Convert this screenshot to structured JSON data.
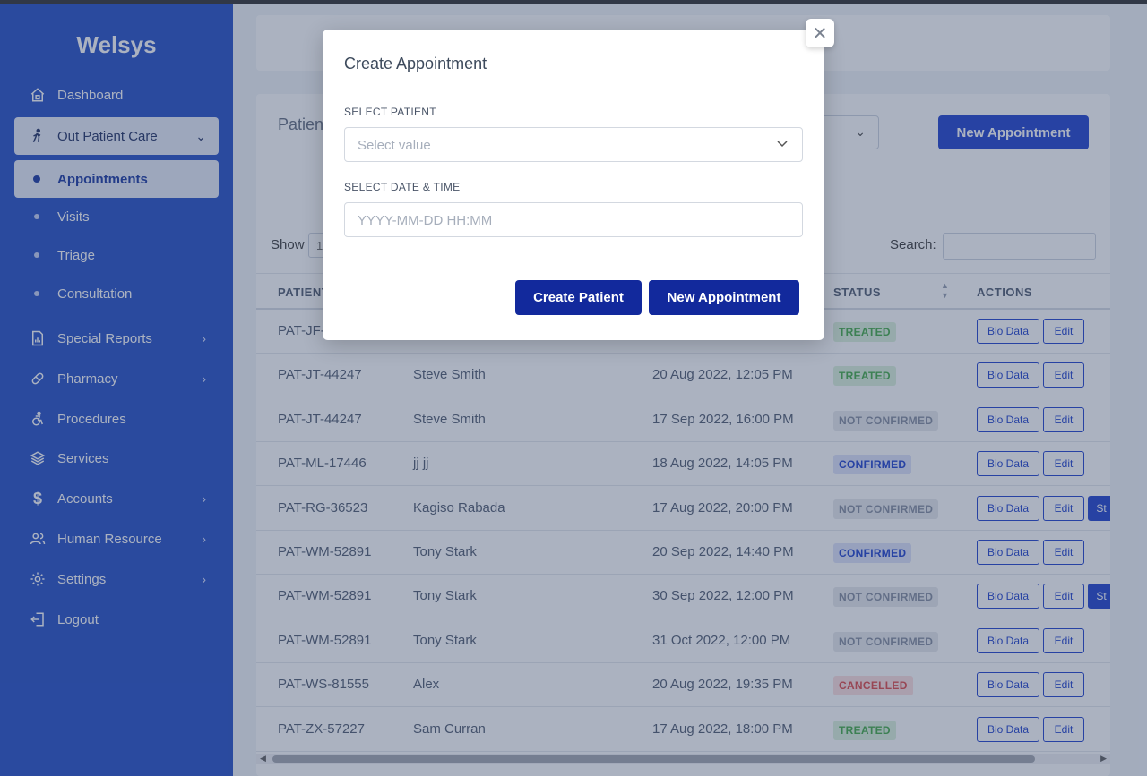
{
  "app": {
    "brand": "Welsys"
  },
  "sidebar": {
    "items": [
      {
        "label": "Dashboard",
        "icon": "home-icon"
      },
      {
        "label": "Out Patient Care",
        "icon": "walking-icon"
      },
      {
        "label": "Appointments"
      },
      {
        "label": "Visits"
      },
      {
        "label": "Triage"
      },
      {
        "label": "Consultation"
      },
      {
        "label": "Special Reports",
        "icon": "report-icon"
      },
      {
        "label": "Pharmacy",
        "icon": "pill-icon"
      },
      {
        "label": "Procedures",
        "icon": "accessibility-icon"
      },
      {
        "label": "Services",
        "icon": "layers-icon"
      },
      {
        "label": "Accounts",
        "icon": "dollar-icon"
      },
      {
        "label": "Human Resource",
        "icon": "users-icon"
      },
      {
        "label": "Settings",
        "icon": "gear-icon"
      },
      {
        "label": "Logout",
        "icon": "logout-icon"
      }
    ]
  },
  "page": {
    "section_title": "Patien",
    "new_appointment_label": "New Appointment",
    "show_label": "Show",
    "show_value": "1",
    "search_label": "Search:"
  },
  "table": {
    "headers": [
      "PATIENT",
      "STATUS",
      "ACTIONS"
    ],
    "bio_label": "Bio Data",
    "edit_label": "Edit",
    "start_label": "St",
    "rows": [
      {
        "patient": "PAT-JF-",
        "name": "",
        "date": "",
        "status": "TREATED"
      },
      {
        "patient": "PAT-JT-44247",
        "name": "Steve Smith",
        "date": "20 Aug 2022, 12:05 PM",
        "status": "TREATED"
      },
      {
        "patient": "PAT-JT-44247",
        "name": "Steve Smith",
        "date": "17 Sep 2022, 16:00 PM",
        "status": "NOT CONFIRMED"
      },
      {
        "patient": "PAT-ML-17446",
        "name": "jj jj",
        "date": "18 Aug 2022, 14:05 PM",
        "status": "CONFIRMED"
      },
      {
        "patient": "PAT-RG-36523",
        "name": "Kagiso Rabada",
        "date": "17 Aug 2022, 20:00 PM",
        "status": "NOT CONFIRMED"
      },
      {
        "patient": "PAT-WM-52891",
        "name": "Tony Stark",
        "date": "20 Sep 2022, 14:40 PM",
        "status": "CONFIRMED"
      },
      {
        "patient": "PAT-WM-52891",
        "name": "Tony Stark",
        "date": "30 Sep 2022, 12:00 PM",
        "status": "NOT CONFIRMED"
      },
      {
        "patient": "PAT-WM-52891",
        "name": "Tony Stark",
        "date": "31 Oct 2022, 12:00 PM",
        "status": "NOT CONFIRMED"
      },
      {
        "patient": "PAT-WS-81555",
        "name": "Alex",
        "date": "20 Aug 2022, 19:35 PM",
        "status": "CANCELLED"
      },
      {
        "patient": "PAT-ZX-57227",
        "name": "Sam Curran",
        "date": "17 Aug 2022, 18:00 PM",
        "status": "TREATED"
      }
    ]
  },
  "modal": {
    "title": "Create Appointment",
    "patient_label": "SELECT PATIENT",
    "patient_placeholder": "Select value",
    "datetime_label": "SELECT DATE & TIME",
    "datetime_placeholder": "YYYY-MM-DD HH:MM",
    "create_patient_label": "Create Patient",
    "new_appointment_label": "New Appointment",
    "close_glyph": "✕"
  },
  "colors": {
    "sidebar": "#2f57c9",
    "primary": "#2b4bd0",
    "modal_button": "#12299c",
    "treated": "#4caf50",
    "cancelled": "#e05252"
  }
}
